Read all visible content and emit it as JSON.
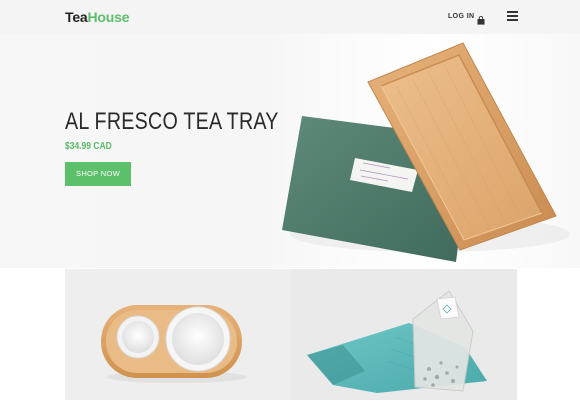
{
  "header": {
    "logo_part1": "Tea",
    "logo_part2": "House",
    "login_label": "LOG IN",
    "cart_icon": "shopping-bag-icon",
    "menu_icon": "hamburger-menu-icon"
  },
  "hero": {
    "title": "AL FRESCO TEA TRAY",
    "price": "$34.99 CAD",
    "cta_label": "SHOP NOW"
  },
  "colors": {
    "accent": "#5cbf6a",
    "text": "#2a2a2a",
    "header_bg": "#f4f4f4"
  }
}
